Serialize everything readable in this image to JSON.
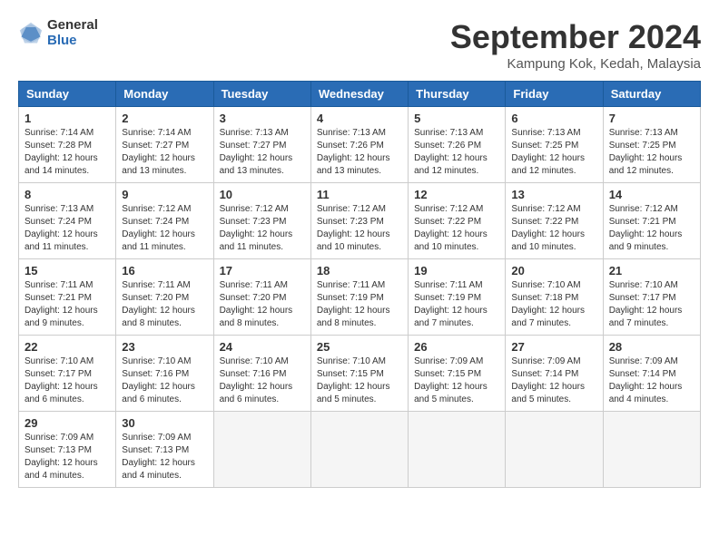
{
  "header": {
    "logo_general": "General",
    "logo_blue": "Blue",
    "title": "September 2024",
    "location": "Kampung Kok, Kedah, Malaysia"
  },
  "weekdays": [
    "Sunday",
    "Monday",
    "Tuesday",
    "Wednesday",
    "Thursday",
    "Friday",
    "Saturday"
  ],
  "weeks": [
    [
      {
        "day": "1",
        "info": "Sunrise: 7:14 AM\nSunset: 7:28 PM\nDaylight: 12 hours\nand 14 minutes."
      },
      {
        "day": "2",
        "info": "Sunrise: 7:14 AM\nSunset: 7:27 PM\nDaylight: 12 hours\nand 13 minutes."
      },
      {
        "day": "3",
        "info": "Sunrise: 7:13 AM\nSunset: 7:27 PM\nDaylight: 12 hours\nand 13 minutes."
      },
      {
        "day": "4",
        "info": "Sunrise: 7:13 AM\nSunset: 7:26 PM\nDaylight: 12 hours\nand 13 minutes."
      },
      {
        "day": "5",
        "info": "Sunrise: 7:13 AM\nSunset: 7:26 PM\nDaylight: 12 hours\nand 12 minutes."
      },
      {
        "day": "6",
        "info": "Sunrise: 7:13 AM\nSunset: 7:25 PM\nDaylight: 12 hours\nand 12 minutes."
      },
      {
        "day": "7",
        "info": "Sunrise: 7:13 AM\nSunset: 7:25 PM\nDaylight: 12 hours\nand 12 minutes."
      }
    ],
    [
      {
        "day": "8",
        "info": "Sunrise: 7:13 AM\nSunset: 7:24 PM\nDaylight: 12 hours\nand 11 minutes."
      },
      {
        "day": "9",
        "info": "Sunrise: 7:12 AM\nSunset: 7:24 PM\nDaylight: 12 hours\nand 11 minutes."
      },
      {
        "day": "10",
        "info": "Sunrise: 7:12 AM\nSunset: 7:23 PM\nDaylight: 12 hours\nand 11 minutes."
      },
      {
        "day": "11",
        "info": "Sunrise: 7:12 AM\nSunset: 7:23 PM\nDaylight: 12 hours\nand 10 minutes."
      },
      {
        "day": "12",
        "info": "Sunrise: 7:12 AM\nSunset: 7:22 PM\nDaylight: 12 hours\nand 10 minutes."
      },
      {
        "day": "13",
        "info": "Sunrise: 7:12 AM\nSunset: 7:22 PM\nDaylight: 12 hours\nand 10 minutes."
      },
      {
        "day": "14",
        "info": "Sunrise: 7:12 AM\nSunset: 7:21 PM\nDaylight: 12 hours\nand 9 minutes."
      }
    ],
    [
      {
        "day": "15",
        "info": "Sunrise: 7:11 AM\nSunset: 7:21 PM\nDaylight: 12 hours\nand 9 minutes."
      },
      {
        "day": "16",
        "info": "Sunrise: 7:11 AM\nSunset: 7:20 PM\nDaylight: 12 hours\nand 8 minutes."
      },
      {
        "day": "17",
        "info": "Sunrise: 7:11 AM\nSunset: 7:20 PM\nDaylight: 12 hours\nand 8 minutes."
      },
      {
        "day": "18",
        "info": "Sunrise: 7:11 AM\nSunset: 7:19 PM\nDaylight: 12 hours\nand 8 minutes."
      },
      {
        "day": "19",
        "info": "Sunrise: 7:11 AM\nSunset: 7:19 PM\nDaylight: 12 hours\nand 7 minutes."
      },
      {
        "day": "20",
        "info": "Sunrise: 7:10 AM\nSunset: 7:18 PM\nDaylight: 12 hours\nand 7 minutes."
      },
      {
        "day": "21",
        "info": "Sunrise: 7:10 AM\nSunset: 7:17 PM\nDaylight: 12 hours\nand 7 minutes."
      }
    ],
    [
      {
        "day": "22",
        "info": "Sunrise: 7:10 AM\nSunset: 7:17 PM\nDaylight: 12 hours\nand 6 minutes."
      },
      {
        "day": "23",
        "info": "Sunrise: 7:10 AM\nSunset: 7:16 PM\nDaylight: 12 hours\nand 6 minutes."
      },
      {
        "day": "24",
        "info": "Sunrise: 7:10 AM\nSunset: 7:16 PM\nDaylight: 12 hours\nand 6 minutes."
      },
      {
        "day": "25",
        "info": "Sunrise: 7:10 AM\nSunset: 7:15 PM\nDaylight: 12 hours\nand 5 minutes."
      },
      {
        "day": "26",
        "info": "Sunrise: 7:09 AM\nSunset: 7:15 PM\nDaylight: 12 hours\nand 5 minutes."
      },
      {
        "day": "27",
        "info": "Sunrise: 7:09 AM\nSunset: 7:14 PM\nDaylight: 12 hours\nand 5 minutes."
      },
      {
        "day": "28",
        "info": "Sunrise: 7:09 AM\nSunset: 7:14 PM\nDaylight: 12 hours\nand 4 minutes."
      }
    ],
    [
      {
        "day": "29",
        "info": "Sunrise: 7:09 AM\nSunset: 7:13 PM\nDaylight: 12 hours\nand 4 minutes."
      },
      {
        "day": "30",
        "info": "Sunrise: 7:09 AM\nSunset: 7:13 PM\nDaylight: 12 hours\nand 4 minutes."
      },
      {
        "day": "",
        "info": ""
      },
      {
        "day": "",
        "info": ""
      },
      {
        "day": "",
        "info": ""
      },
      {
        "day": "",
        "info": ""
      },
      {
        "day": "",
        "info": ""
      }
    ]
  ]
}
